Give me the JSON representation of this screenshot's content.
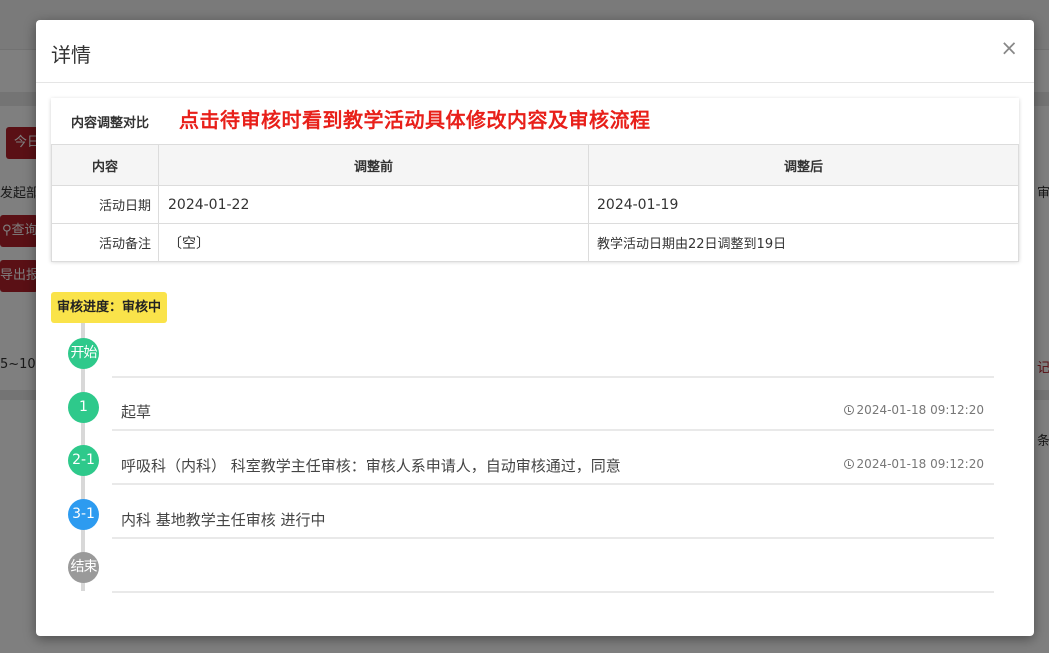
{
  "background": {
    "red_button_1": "今日",
    "filter_label": "发起部",
    "search_button": "查询",
    "export_button": "导出报表",
    "row_text": "5~10",
    "right_label_1": "审",
    "right_label_2": "记",
    "right_label_3": "条"
  },
  "modal": {
    "title": "详情",
    "close_label": "×"
  },
  "compare": {
    "title": "内容调整对比",
    "annotation": "点击待审核时看到教学活动具体修改内容及审核流程",
    "headers": [
      "内容",
      "调整前",
      "调整后"
    ],
    "rows": [
      {
        "label": "活动日期",
        "before": "2024-01-22",
        "after": "2024-01-19"
      },
      {
        "label": "活动备注",
        "before": "〔空〕",
        "after": "教学活动日期由22日调整到19日"
      }
    ]
  },
  "progress": {
    "label": "审核进度：审核中"
  },
  "timeline": [
    {
      "node": "开始",
      "status": "start",
      "text": "",
      "time": ""
    },
    {
      "node": "1",
      "status": "done",
      "text": "起草",
      "time": "2024-01-18 09:12:20"
    },
    {
      "node": "2-1",
      "status": "done",
      "text": "呼吸科（内科） 科室教学主任审核：审核人系申请人，自动审核通过，同意",
      "time": "2024-01-18 09:12:20"
    },
    {
      "node": "3-1",
      "status": "current",
      "text": "内科 基地教学主任审核 进行中",
      "time": ""
    },
    {
      "node": "结束",
      "status": "end",
      "text": "",
      "time": ""
    }
  ],
  "colors": {
    "accent_red": "#e8201a",
    "changed_value": "#e8453c",
    "node_green": "#2ec98b",
    "node_blue": "#2d9bf0",
    "node_gray": "#9a9a9a",
    "badge_yellow": "#fae34a"
  }
}
